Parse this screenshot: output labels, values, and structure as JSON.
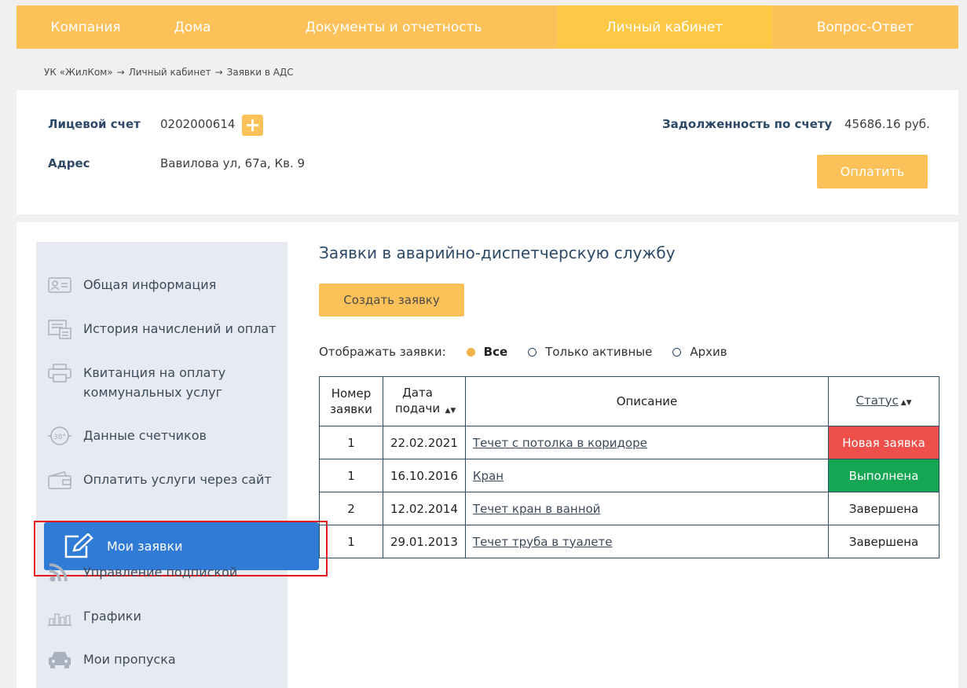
{
  "nav": {
    "items": [
      "Компания",
      "Дома",
      "Документы и отчетность",
      "Личный кабинет",
      "Вопрос-Ответ"
    ],
    "active_index": 3
  },
  "breadcrumb": [
    "УК «ЖилКом»",
    "→",
    "Личный кабинет",
    "→",
    "Заявки в АДС"
  ],
  "account": {
    "account_label": "Лицевой счет",
    "account_number": "0202000614",
    "address_label": "Адрес",
    "address_value": "Вавилова ул, 67а, Кв. 9",
    "debt_label": "Задолженность по счету",
    "debt_value": "45686.16 руб.",
    "pay_button": "Оплатить"
  },
  "sidebar": {
    "items": [
      {
        "label": "Общая информация",
        "icon": "id-card-icon"
      },
      {
        "label": "История начислений и оплат",
        "icon": "calculator-icon"
      },
      {
        "label": "Квитанция на оплату коммунальных услуг",
        "icon": "printer-icon"
      },
      {
        "label": "Данные счетчиков",
        "icon": "meter-icon"
      },
      {
        "label": "Оплатить услуги через сайт",
        "icon": "wallet-icon"
      },
      {
        "label": "Мои заявки",
        "icon": "edit-icon"
      },
      {
        "label": "Управление подпиской",
        "icon": "rss-icon"
      },
      {
        "label": "Графики",
        "icon": "bar-chart-icon"
      },
      {
        "label": "Мои пропуска",
        "icon": "car-icon"
      }
    ],
    "active_index": 5
  },
  "content": {
    "title": "Заявки в аварийно-диспетчерскую службу",
    "create_button": "Создать заявку",
    "filter_label": "Отображать заявки:",
    "filter_options": [
      "Все",
      "Только активные",
      "Архив"
    ],
    "filter_selected": 0
  },
  "table": {
    "headers": [
      "Номер заявки",
      "Дата подачи",
      "Описание",
      "Статус"
    ],
    "rows": [
      {
        "number": "1",
        "date": "22.02.2021",
        "description": "Течет с потолка в коридоре",
        "status": "Новая заявка",
        "status_color": "#ef4f4a"
      },
      {
        "number": "1",
        "date": "16.10.2016",
        "description": "Кран",
        "status": "Выполнена",
        "status_color": "#14a653"
      },
      {
        "number": "2",
        "date": "12.02.2014",
        "description": "Течет кран в ванной",
        "status": "Завершена",
        "status_color": ""
      },
      {
        "number": "1",
        "date": "29.01.2013",
        "description": "Течет труба в туалете",
        "status": "Завершена",
        "status_color": ""
      }
    ]
  },
  "colors": {
    "accent": "#fdc15a",
    "active_blue": "#2f7bd6",
    "text_dark_blue": "#2e4a66"
  }
}
